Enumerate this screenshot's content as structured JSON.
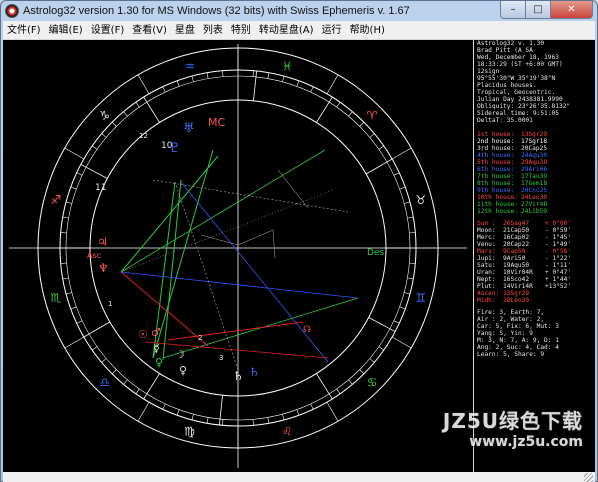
{
  "window": {
    "title": "Astrolog32 version 1.30 for MS Windows (32 bits) with Swiss Ephemeris v. 1.67",
    "minimize_glyph": "–",
    "maximize_glyph": "□",
    "close_glyph": "✕"
  },
  "menu": [
    "文件(F)",
    "编辑(E)",
    "设置(F)",
    "查看(V)",
    "星盘",
    "列表",
    "特别",
    "转动星盘(A)",
    "运行",
    "帮助(H)"
  ],
  "chart": {
    "angle_labels": {
      "mc": "MC",
      "des": "Des",
      "asc": "Asc"
    },
    "house_numbers": [
      "1",
      "2",
      "3",
      "10",
      "11",
      "12"
    ],
    "colors": {
      "ring": "#ffffff",
      "aspect_green": "#2ecc40",
      "aspect_red": "#e02020",
      "aspect_blue": "#3355ff",
      "aspect_gray": "#999999"
    }
  },
  "info": {
    "header": [
      "Astrolog32 v. 1.30",
      "Brad Pitt  (A SA",
      "Wed, December 18, 1963",
      "18:33:29 (ST +6:00 GMT)",
      "12sign",
      " 95°55'30\"W 35°19'38\"N",
      "Placidus houses.",
      "Tropical, Geocentric.",
      "Julian Day  2438381.9990",
      "Obliquity: 23°26'35.8132\"",
      "Sidereal time:  9:51:05",
      "DeltaT:  35.0001"
    ],
    "houses": [
      {
        "label": "1st house:",
        "value": "13Sgr29",
        "color": "#ff4444"
      },
      {
        "label": "2nd house:",
        "value": "17Sgr18",
        "color": "#ffffff"
      },
      {
        "label": "3rd house:",
        "value": "20Cap25",
        "color": "#e6e6e6"
      },
      {
        "label": "4th house:",
        "value": "24Aqu30",
        "color": "#3b6dff"
      },
      {
        "label": "5th house:",
        "value": "29Aqu38",
        "color": "#ff4444"
      },
      {
        "label": "6th house:",
        "value": "29Ari06",
        "color": "#3b6dff"
      },
      {
        "label": "7th house:",
        "value": "17Tau39",
        "color": "#2ecc40"
      },
      {
        "label": "8th house:",
        "value": "17Gem18",
        "color": "#2ecc40"
      },
      {
        "label": "9th house:",
        "value": "20Cnc25",
        "color": "#3b6dff"
      },
      {
        "label": "10th house:",
        "value": "24Leo30",
        "color": "#ff4444"
      },
      {
        "label": "11th house:",
        "value": "27Vir48",
        "color": "#2ecc40"
      },
      {
        "label": "12th house:",
        "value": "24Lib59",
        "color": "#2ecc40"
      }
    ],
    "planets": [
      {
        "label": "Sun :",
        "value": "26Sag47",
        "lat": "+ 0°00'",
        "color": "#ff4444"
      },
      {
        "label": "Moon:",
        "value": "21Cap50",
        "lat": "- 0°59'",
        "color": "#e6e6e6"
      },
      {
        "label": "Merc:",
        "value": "16Cap02",
        "lat": "- 1°45'",
        "color": "#e6e6e6"
      },
      {
        "label": "Venu:",
        "value": "20Cap22",
        "lat": "- 1°49'",
        "color": "#e6e6e6"
      },
      {
        "label": "Mars:",
        "value": "9Cap50",
        "lat": "- 0°58'",
        "color": "#ff4444"
      },
      {
        "label": "Jupi:",
        "value": "9Ari50",
        "lat": "- 1°22'",
        "color": "#e6e6e6"
      },
      {
        "label": "Satu:",
        "value": "19Aqu50",
        "lat": "- 1°11'",
        "color": "#e6e6e6"
      },
      {
        "label": "Uran:",
        "value": "10Vir04R",
        "lat": "+ 0°47'",
        "color": "#e6e6e6"
      },
      {
        "label": "Nept:",
        "value": "16Sco42",
        "lat": "+ 1°44'",
        "color": "#e6e6e6"
      },
      {
        "label": "Plut:",
        "value": "14Vir14R",
        "lat": "+13°52'",
        "color": "#e6e6e6"
      },
      {
        "label": "Ascen:",
        "value": "13Sgr29",
        "lat": "",
        "color": "#ff4444"
      },
      {
        "label": "Midh:",
        "value": "28Leo30",
        "lat": "",
        "color": "#ff4444"
      }
    ],
    "footer": [
      "Fire: 3, Earth: 7,",
      "Air : 2, Water: 2,",
      "Car: 5, Fix: 6, Mut: 3",
      "Yang: 5, Yin: 9",
      "M: 3, N: 7, A: 9, D: 1",
      "Ang: 2, Suc: 4, Cad: 4",
      "Learn: 5, Share: 9"
    ]
  },
  "watermark": {
    "top": "JZ5U绿色下载",
    "bottom": "www.jz5u.com"
  }
}
